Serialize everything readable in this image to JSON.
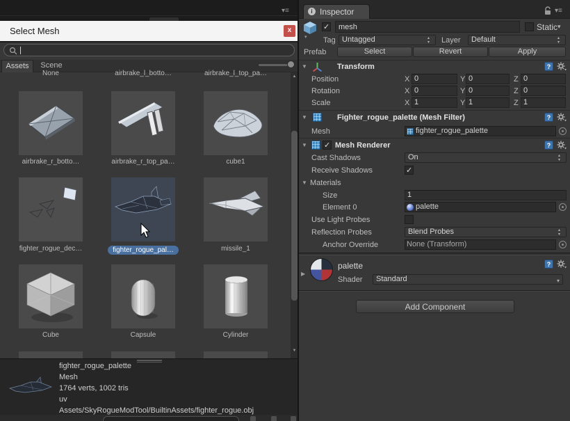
{
  "icons": {
    "pane_menu": "≡",
    "dropdown_arrow": "▾",
    "up_arrow": "▲",
    "down_arrow": "▼",
    "foldout_open": "▼",
    "foldout_closed": "▶",
    "check": "✓",
    "close": "x",
    "info": "i",
    "help": "?",
    "static_arrow": "▾"
  },
  "colors": {
    "selection_blue": "#4a70a0",
    "close_red": "#c4504c",
    "panel_bg": "#383838",
    "dialog_header_bg": "#f4f4f4",
    "field_bg": "#2f2f2f"
  },
  "select_mesh_dialog": {
    "title": "Select Mesh",
    "search_value": "",
    "tabs": [
      {
        "label": "Assets"
      },
      {
        "label": "Scene"
      }
    ],
    "grid": {
      "top_labels": [
        "None",
        "airbrake_l_botto…",
        "airbrake_l_top_pa…"
      ],
      "tiles": [
        {
          "label": "airbrake_r_botto…"
        },
        {
          "label": "airbrake_r_top_pa…"
        },
        {
          "label": "cube1"
        },
        {
          "label": "fighter_rogue_dec…"
        },
        {
          "label": "fighter_rogue_pal…",
          "selected": true
        },
        {
          "label": "missile_1"
        },
        {
          "label": "Cube"
        },
        {
          "label": "Capsule"
        },
        {
          "label": "Cylinder"
        }
      ]
    },
    "preview": {
      "name": "fighter_rogue_palette",
      "type": "Mesh",
      "stats": "1764 verts, 1002 tris",
      "channels": "uv",
      "path": "Assets/SkyRogueModTool/BuiltinAssets/fighter_rogue.obj"
    }
  },
  "inspector": {
    "tab_label": "Inspector",
    "gameobject": {
      "name": "mesh",
      "static_label": "Static"
    },
    "tag_row": {
      "tag_label": "Tag",
      "tag_value": "Untagged",
      "layer_label": "Layer",
      "layer_value": "Default"
    },
    "prefab_row": {
      "label": "Prefab",
      "buttons": [
        "Select",
        "Revert",
        "Apply"
      ]
    },
    "transform": {
      "title": "Transform",
      "axes": [
        "X",
        "Y",
        "Z"
      ],
      "rows": [
        {
          "label": "Position",
          "x": "0",
          "y": "0",
          "z": "0"
        },
        {
          "label": "Rotation",
          "x": "0",
          "y": "0",
          "z": "0"
        },
        {
          "label": "Scale",
          "x": "1",
          "y": "1",
          "z": "1"
        }
      ]
    },
    "mesh_filter": {
      "title": "Fighter_rogue_palette (Mesh Filter)",
      "mesh_label": "Mesh",
      "mesh_value": "fighter_rogue_palette"
    },
    "mesh_renderer": {
      "title": "Mesh Renderer",
      "cast_shadows_label": "Cast Shadows",
      "cast_shadows_value": "On",
      "receive_shadows_label": "Receive Shadows",
      "materials_label": "Materials",
      "size_label": "Size",
      "size_value": "1",
      "element0_label": "Element 0",
      "element0_value": "palette",
      "use_light_probes_label": "Use Light Probes",
      "reflection_probes_label": "Reflection Probes",
      "reflection_probes_value": "Blend Probes",
      "anchor_override_label": "Anchor Override",
      "anchor_override_value": "None (Transform)"
    },
    "material": {
      "name": "palette",
      "shader_label": "Shader",
      "shader_value": "Standard"
    },
    "add_component_label": "Add Component"
  }
}
